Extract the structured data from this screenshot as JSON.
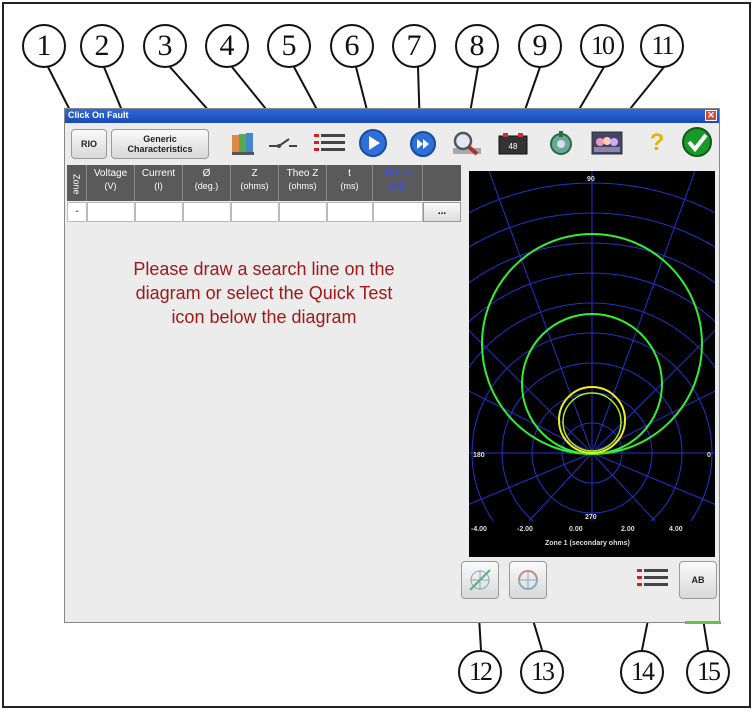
{
  "window": {
    "title": "Click On Fault",
    "close_label": "✕"
  },
  "toolbar": {
    "rio_label": "RIO",
    "generic_label_1": "Generic",
    "generic_label_2": "Characteristics",
    "icons": [
      "book-icon",
      "breaker-icon",
      "list-icon",
      "play-icon",
      "fast-forward-icon",
      "search-magnifier-icon",
      "battery-icon",
      "settings-gear-icon",
      "team-icon",
      "help-icon",
      "ok-check-icon"
    ],
    "battery_text": "48",
    "help_text": "?"
  },
  "table": {
    "zone_header": "Zone",
    "columns": [
      {
        "name": "Voltage",
        "unit": "(V)"
      },
      {
        "name": "Current",
        "unit": "(I)"
      },
      {
        "name": "Ø",
        "unit": "(deg.)"
      },
      {
        "name": "Z",
        "unit": "(ohms)"
      },
      {
        "name": "Theo Z",
        "unit": "(ohms)"
      },
      {
        "name": "t",
        "unit": "(ms)"
      },
      {
        "name": "Theo t",
        "unit": "(ms)"
      }
    ],
    "row_zone": "-",
    "more_label": "..."
  },
  "message": [
    "Please draw a search line on the",
    "diagram or select the Quick Test",
    "icon below the diagram"
  ],
  "diagram": {
    "angle_top": "90",
    "angle_left": "180",
    "angle_right": "0",
    "angle_bottom": "270",
    "x_ticks": [
      "-4.00",
      "-2.00",
      "0.00",
      "2.00",
      "4.00"
    ],
    "x_label": "Zone 1 (secondary ohms)"
  },
  "bottom": {
    "ab_label": "AB"
  },
  "callouts": [
    "1",
    "2",
    "3",
    "4",
    "5",
    "6",
    "7",
    "8",
    "9",
    "10",
    "11",
    "12",
    "13",
    "14",
    "15"
  ],
  "colors": {
    "message": "#a01818",
    "zone_green": "#33ee33",
    "zone_yellow": "#eeee22",
    "grid_blue": "#2233cc",
    "titlebar": "#2e6ad6"
  }
}
